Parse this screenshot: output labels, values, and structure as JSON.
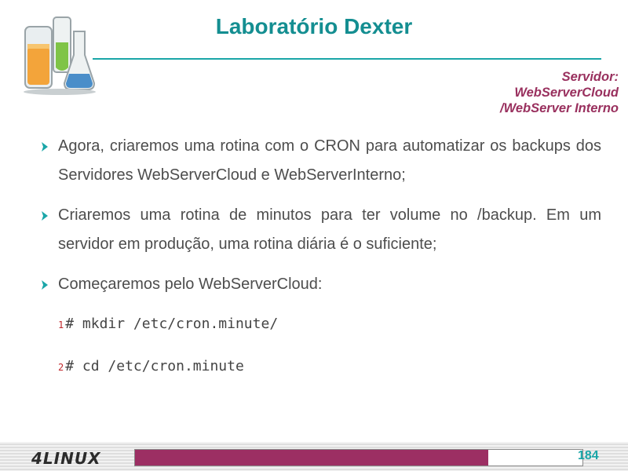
{
  "header": {
    "title": "Laboratório Dexter",
    "server_line1": "Servidor:",
    "server_line2": "WebServerCloud",
    "server_line3": "/WebServer Interno"
  },
  "bullets": [
    "Agora, criaremos uma rotina com o CRON para automatizar os backups dos Servidores WebServerCloud e WebServerInterno;",
    "Criaremos uma rotina de minutos para ter volume no /backup. Em um servidor em produção, uma rotina diária é o suficiente;",
    "Começaremos pelo WebServerCloud:"
  ],
  "commands": [
    {
      "num": "1",
      "text": "# mkdir /etc/cron.minute/"
    },
    {
      "num": "2",
      "text": "# cd /etc/cron.minute"
    }
  ],
  "footer": {
    "brand": "4LINUX",
    "page_number": "184",
    "progress_fraction": 0.79
  },
  "colors": {
    "title": "#148e91",
    "server": "#99305e",
    "progress": "#9c2f63",
    "page_number": "#1aa6a8"
  }
}
